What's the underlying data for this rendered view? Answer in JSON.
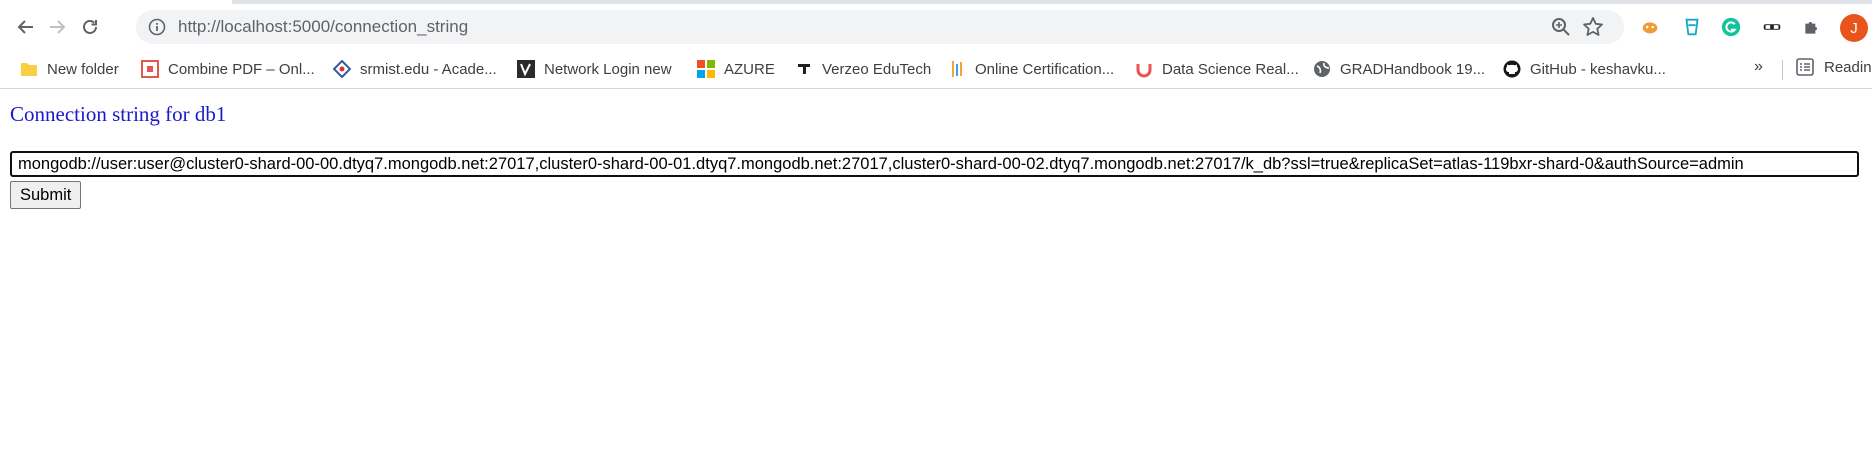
{
  "browser": {
    "url_host": "http://localhost",
    "url_rest": ":5000/connection_string"
  },
  "bookmarks": [
    {
      "label": "New folder",
      "icon": "folder-icon"
    },
    {
      "label": "Combine PDF – Onl...",
      "icon": "pdf-icon"
    },
    {
      "label": "srmist.edu - Acade...",
      "icon": "srm-icon"
    },
    {
      "label": "Network Login new",
      "icon": "network-login-icon"
    },
    {
      "label": "AZURE",
      "icon": "microsoft-icon"
    },
    {
      "label": "Verzeo EduTech",
      "icon": "verzeo-icon"
    },
    {
      "label": "Online Certification...",
      "icon": "certification-icon"
    },
    {
      "label": "Data Science Real...",
      "icon": "udemy-icon"
    },
    {
      "label": "GRADHandbook 19...",
      "icon": "globe-icon"
    },
    {
      "label": "GitHub - keshavku...",
      "icon": "github-icon"
    }
  ],
  "bookmarks_more": "»",
  "reading_list_label": "Reading",
  "avatar_initial": "J",
  "page": {
    "title": "Connection string for db1",
    "connection_string": "mongodb://user:user@cluster0-shard-00-00.dtyq7.mongodb.net:27017,cluster0-shard-00-01.dtyq7.mongodb.net:27017,cluster0-shard-00-02.dtyq7.mongodb.net:27017/k_db?ssl=true&replicaSet=atlas-119bxr-shard-0&authSource=admin",
    "submit_label": "Submit"
  }
}
